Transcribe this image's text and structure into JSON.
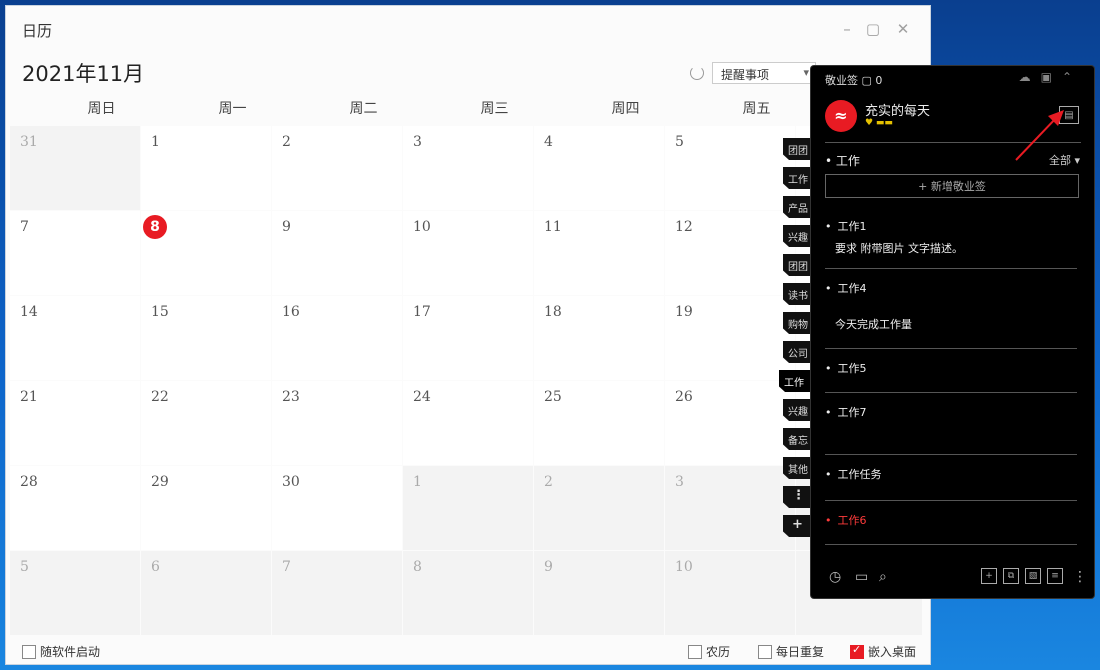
{
  "window": {
    "title": "日历",
    "controls": {
      "minimize": "–",
      "maximize": "▢",
      "close": "✕"
    }
  },
  "header": {
    "month": "2021年11月",
    "filter_value": "提醒事项"
  },
  "weekdays": [
    "周日",
    "周一",
    "周二",
    "周三",
    "周四",
    "周五"
  ],
  "calendar": {
    "today": "8",
    "weeks": [
      [
        {
          "d": "31",
          "o": true
        },
        {
          "d": "1"
        },
        {
          "d": "2"
        },
        {
          "d": "3"
        },
        {
          "d": "4"
        },
        {
          "d": "5"
        }
      ],
      [
        {
          "d": "7"
        },
        {
          "d": "8",
          "today": true
        },
        {
          "d": "9"
        },
        {
          "d": "10"
        },
        {
          "d": "11"
        },
        {
          "d": "12"
        }
      ],
      [
        {
          "d": "14"
        },
        {
          "d": "15"
        },
        {
          "d": "16"
        },
        {
          "d": "17"
        },
        {
          "d": "18"
        },
        {
          "d": "19"
        }
      ],
      [
        {
          "d": "21"
        },
        {
          "d": "22"
        },
        {
          "d": "23"
        },
        {
          "d": "24"
        },
        {
          "d": "25"
        },
        {
          "d": "26"
        }
      ],
      [
        {
          "d": "28"
        },
        {
          "d": "29"
        },
        {
          "d": "30"
        },
        {
          "d": "1",
          "o": true
        },
        {
          "d": "2",
          "o": true
        },
        {
          "d": "3",
          "o": true
        }
      ],
      [
        {
          "d": "5",
          "o": true
        },
        {
          "d": "6",
          "o": true
        },
        {
          "d": "7",
          "o": true
        },
        {
          "d": "8",
          "o": true
        },
        {
          "d": "9",
          "o": true
        },
        {
          "d": "10",
          "o": true
        }
      ]
    ]
  },
  "footer": {
    "autostart": "随软件启动",
    "lunar": "农历",
    "daily_repeat": "每日重复",
    "embed_desktop": "嵌入桌面",
    "embed_checked": true
  },
  "side_tabs": [
    "团团",
    "工作",
    "产品",
    "兴趣",
    "团团",
    "读书",
    "购物",
    "公司",
    "工作",
    "兴趣",
    "备忘",
    "其他"
  ],
  "panel": {
    "header_title": "敬业签",
    "header_count": "0",
    "user_name": "充实的每天",
    "user_level": "♥ ▬▬",
    "group_label": "工作",
    "group_filter": "全部",
    "add_note": "+ 新增敬业签",
    "notes": [
      {
        "title": "工作1",
        "body": "要求 附带图片 文字描述。"
      },
      {
        "title": "工作4",
        "body": "今天完成工作量"
      },
      {
        "title": "工作5",
        "body": ""
      },
      {
        "title": "工作7",
        "body": ""
      },
      {
        "title": "工作任务",
        "body": ""
      },
      {
        "title": "工作6",
        "body": "",
        "red": true
      }
    ]
  },
  "colors": {
    "accent": "#e81b23",
    "panel_bg": "#000000",
    "window_bg": "#fbfbfb"
  }
}
